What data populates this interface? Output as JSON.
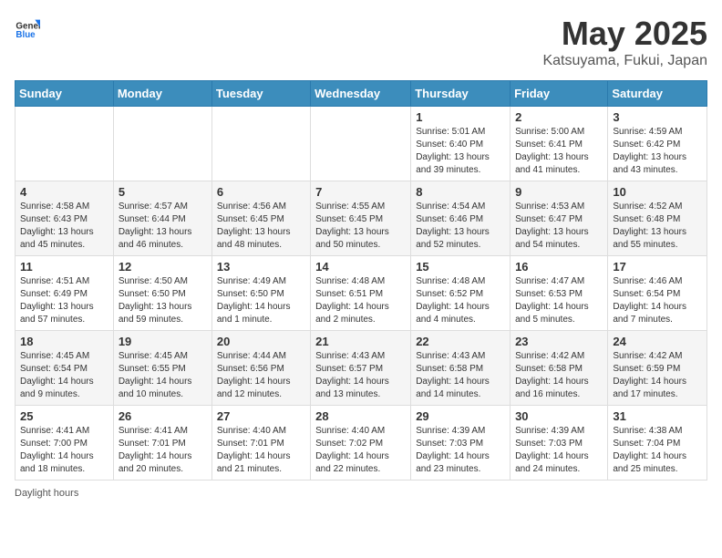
{
  "header": {
    "logo_general": "General",
    "logo_blue": "Blue",
    "title": "May 2025",
    "subtitle": "Katsuyama, Fukui, Japan"
  },
  "days_of_week": [
    "Sunday",
    "Monday",
    "Tuesday",
    "Wednesday",
    "Thursday",
    "Friday",
    "Saturday"
  ],
  "weeks": [
    [
      {
        "day": "",
        "info": ""
      },
      {
        "day": "",
        "info": ""
      },
      {
        "day": "",
        "info": ""
      },
      {
        "day": "",
        "info": ""
      },
      {
        "day": "1",
        "info": "Sunrise: 5:01 AM\nSunset: 6:40 PM\nDaylight: 13 hours\nand 39 minutes."
      },
      {
        "day": "2",
        "info": "Sunrise: 5:00 AM\nSunset: 6:41 PM\nDaylight: 13 hours\nand 41 minutes."
      },
      {
        "day": "3",
        "info": "Sunrise: 4:59 AM\nSunset: 6:42 PM\nDaylight: 13 hours\nand 43 minutes."
      }
    ],
    [
      {
        "day": "4",
        "info": "Sunrise: 4:58 AM\nSunset: 6:43 PM\nDaylight: 13 hours\nand 45 minutes."
      },
      {
        "day": "5",
        "info": "Sunrise: 4:57 AM\nSunset: 6:44 PM\nDaylight: 13 hours\nand 46 minutes."
      },
      {
        "day": "6",
        "info": "Sunrise: 4:56 AM\nSunset: 6:45 PM\nDaylight: 13 hours\nand 48 minutes."
      },
      {
        "day": "7",
        "info": "Sunrise: 4:55 AM\nSunset: 6:45 PM\nDaylight: 13 hours\nand 50 minutes."
      },
      {
        "day": "8",
        "info": "Sunrise: 4:54 AM\nSunset: 6:46 PM\nDaylight: 13 hours\nand 52 minutes."
      },
      {
        "day": "9",
        "info": "Sunrise: 4:53 AM\nSunset: 6:47 PM\nDaylight: 13 hours\nand 54 minutes."
      },
      {
        "day": "10",
        "info": "Sunrise: 4:52 AM\nSunset: 6:48 PM\nDaylight: 13 hours\nand 55 minutes."
      }
    ],
    [
      {
        "day": "11",
        "info": "Sunrise: 4:51 AM\nSunset: 6:49 PM\nDaylight: 13 hours\nand 57 minutes."
      },
      {
        "day": "12",
        "info": "Sunrise: 4:50 AM\nSunset: 6:50 PM\nDaylight: 13 hours\nand 59 minutes."
      },
      {
        "day": "13",
        "info": "Sunrise: 4:49 AM\nSunset: 6:50 PM\nDaylight: 14 hours\nand 1 minute."
      },
      {
        "day": "14",
        "info": "Sunrise: 4:48 AM\nSunset: 6:51 PM\nDaylight: 14 hours\nand 2 minutes."
      },
      {
        "day": "15",
        "info": "Sunrise: 4:48 AM\nSunset: 6:52 PM\nDaylight: 14 hours\nand 4 minutes."
      },
      {
        "day": "16",
        "info": "Sunrise: 4:47 AM\nSunset: 6:53 PM\nDaylight: 14 hours\nand 5 minutes."
      },
      {
        "day": "17",
        "info": "Sunrise: 4:46 AM\nSunset: 6:54 PM\nDaylight: 14 hours\nand 7 minutes."
      }
    ],
    [
      {
        "day": "18",
        "info": "Sunrise: 4:45 AM\nSunset: 6:54 PM\nDaylight: 14 hours\nand 9 minutes."
      },
      {
        "day": "19",
        "info": "Sunrise: 4:45 AM\nSunset: 6:55 PM\nDaylight: 14 hours\nand 10 minutes."
      },
      {
        "day": "20",
        "info": "Sunrise: 4:44 AM\nSunset: 6:56 PM\nDaylight: 14 hours\nand 12 minutes."
      },
      {
        "day": "21",
        "info": "Sunrise: 4:43 AM\nSunset: 6:57 PM\nDaylight: 14 hours\nand 13 minutes."
      },
      {
        "day": "22",
        "info": "Sunrise: 4:43 AM\nSunset: 6:58 PM\nDaylight: 14 hours\nand 14 minutes."
      },
      {
        "day": "23",
        "info": "Sunrise: 4:42 AM\nSunset: 6:58 PM\nDaylight: 14 hours\nand 16 minutes."
      },
      {
        "day": "24",
        "info": "Sunrise: 4:42 AM\nSunset: 6:59 PM\nDaylight: 14 hours\nand 17 minutes."
      }
    ],
    [
      {
        "day": "25",
        "info": "Sunrise: 4:41 AM\nSunset: 7:00 PM\nDaylight: 14 hours\nand 18 minutes."
      },
      {
        "day": "26",
        "info": "Sunrise: 4:41 AM\nSunset: 7:01 PM\nDaylight: 14 hours\nand 20 minutes."
      },
      {
        "day": "27",
        "info": "Sunrise: 4:40 AM\nSunset: 7:01 PM\nDaylight: 14 hours\nand 21 minutes."
      },
      {
        "day": "28",
        "info": "Sunrise: 4:40 AM\nSunset: 7:02 PM\nDaylight: 14 hours\nand 22 minutes."
      },
      {
        "day": "29",
        "info": "Sunrise: 4:39 AM\nSunset: 7:03 PM\nDaylight: 14 hours\nand 23 minutes."
      },
      {
        "day": "30",
        "info": "Sunrise: 4:39 AM\nSunset: 7:03 PM\nDaylight: 14 hours\nand 24 minutes."
      },
      {
        "day": "31",
        "info": "Sunrise: 4:38 AM\nSunset: 7:04 PM\nDaylight: 14 hours\nand 25 minutes."
      }
    ]
  ],
  "footer": {
    "note": "Daylight hours"
  }
}
